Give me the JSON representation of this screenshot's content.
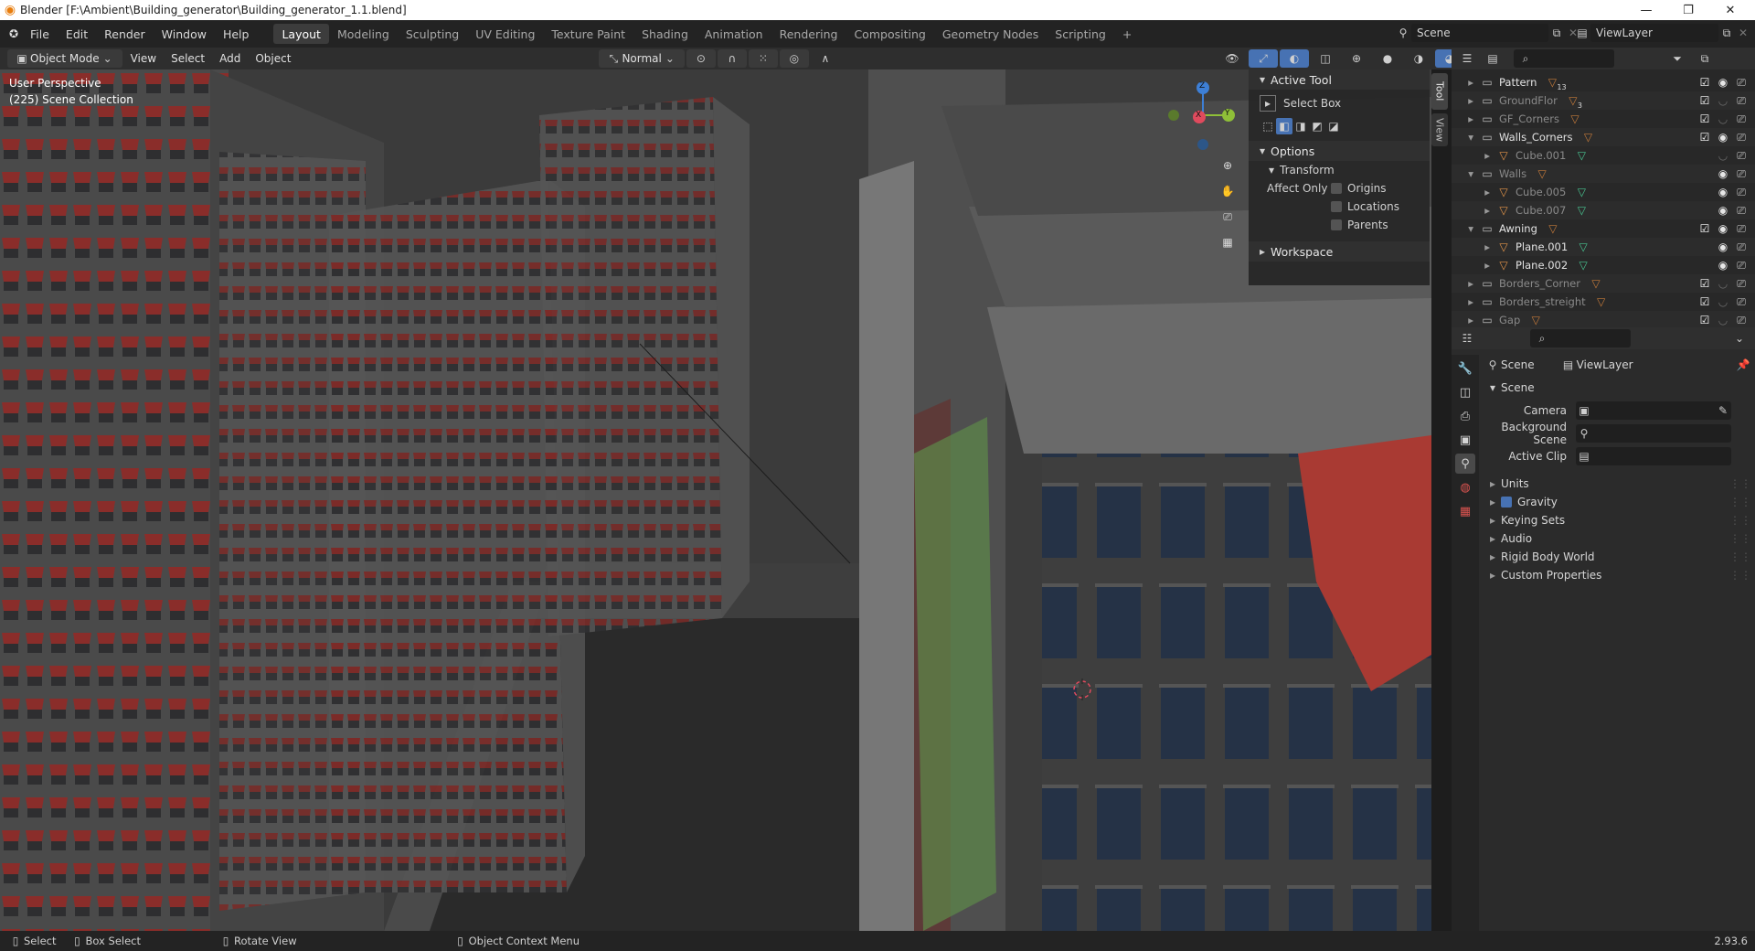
{
  "window": {
    "title": "Blender [F:\\Ambient\\Building_generator\\Building_generator_1.1.blend]",
    "minimize_glyph": "—",
    "restore_glyph": "❐",
    "close_glyph": "✕"
  },
  "menus": [
    "File",
    "Edit",
    "Render",
    "Window",
    "Help"
  ],
  "workspaces": [
    {
      "label": "Layout",
      "active": true
    },
    {
      "label": "Modeling",
      "active": false
    },
    {
      "label": "Sculpting",
      "active": false
    },
    {
      "label": "UV Editing",
      "active": false
    },
    {
      "label": "Texture Paint",
      "active": false
    },
    {
      "label": "Shading",
      "active": false
    },
    {
      "label": "Animation",
      "active": false
    },
    {
      "label": "Rendering",
      "active": false
    },
    {
      "label": "Compositing",
      "active": false
    },
    {
      "label": "Geometry Nodes",
      "active": false
    },
    {
      "label": "Scripting",
      "active": false
    }
  ],
  "add_workspace": "+",
  "scene_selector": {
    "value": "Scene"
  },
  "viewlayer_selector": {
    "value": "ViewLayer"
  },
  "viewport_header": {
    "mode": "Object Mode",
    "menus": [
      "View",
      "Select",
      "Add",
      "Object"
    ],
    "orientation": "Normal"
  },
  "viewport": {
    "perspective_label": "User Perspective",
    "collection_label": "(225) Scene Collection",
    "gizmo": {
      "x": "X",
      "y": "Y",
      "z": "Z"
    }
  },
  "n_panel": {
    "tabs": [
      "Tool",
      "View"
    ],
    "active_tool_title": "Active Tool",
    "active_tool_name": "Select Box",
    "options_title": "Options",
    "transform_title": "Transform",
    "affect_only_label": "Affect Only",
    "affect_options": [
      {
        "label": "Origins",
        "checked": false
      },
      {
        "label": "Locations",
        "checked": false
      },
      {
        "label": "Parents",
        "checked": false
      }
    ],
    "workspace_title": "Workspace"
  },
  "outliner": {
    "rows": [
      {
        "label": "Pattern",
        "indent": 1,
        "expanded": false,
        "dim": false,
        "badge": "13",
        "checked": true,
        "visible": true
      },
      {
        "label": "GroundFlor",
        "indent": 1,
        "expanded": false,
        "dim": true,
        "badge": "3",
        "checked": true,
        "visible": false
      },
      {
        "label": "GF_Corners",
        "indent": 1,
        "expanded": false,
        "dim": true,
        "badge": "",
        "checked": true,
        "visible": false
      },
      {
        "label": "Walls_Corners",
        "indent": 1,
        "expanded": true,
        "dim": false,
        "badge": "",
        "checked": true,
        "visible": true
      },
      {
        "label": "Cube.001",
        "indent": 2,
        "expanded": false,
        "dim": true,
        "badge": "",
        "checked": null,
        "visible": false
      },
      {
        "label": "Walls",
        "indent": 1,
        "expanded": true,
        "dim": true,
        "badge": "",
        "checked": null,
        "visible": true
      },
      {
        "label": "Cube.005",
        "indent": 2,
        "expanded": false,
        "dim": true,
        "badge": "",
        "checked": null,
        "visible": true
      },
      {
        "label": "Cube.007",
        "indent": 2,
        "expanded": false,
        "dim": true,
        "badge": "",
        "checked": null,
        "visible": true
      },
      {
        "label": "Awning",
        "indent": 1,
        "expanded": true,
        "dim": false,
        "badge": "",
        "checked": true,
        "visible": true
      },
      {
        "label": "Plane.001",
        "indent": 2,
        "expanded": false,
        "dim": false,
        "badge": "",
        "checked": null,
        "visible": true
      },
      {
        "label": "Plane.002",
        "indent": 2,
        "expanded": false,
        "dim": false,
        "badge": "",
        "checked": null,
        "visible": true
      },
      {
        "label": "Borders_Corner",
        "indent": 1,
        "expanded": false,
        "dim": true,
        "badge": "",
        "checked": true,
        "visible": false
      },
      {
        "label": "Borders_streight",
        "indent": 1,
        "expanded": false,
        "dim": true,
        "badge": "",
        "checked": true,
        "visible": false
      },
      {
        "label": "Gap",
        "indent": 1,
        "expanded": false,
        "dim": true,
        "badge": "",
        "checked": true,
        "visible": false
      }
    ]
  },
  "properties": {
    "breadcrumb_scene": "Scene",
    "breadcrumb_viewlayer": "ViewLayer",
    "section_title": "Scene",
    "fields": [
      {
        "label": "Camera",
        "value": ""
      },
      {
        "label": "Background Scene",
        "value": ""
      },
      {
        "label": "Active Clip",
        "value": ""
      }
    ],
    "panels": [
      {
        "label": "Units",
        "checkbox": false
      },
      {
        "label": "Gravity",
        "checkbox": true
      },
      {
        "label": "Keying Sets",
        "checkbox": false
      },
      {
        "label": "Audio",
        "checkbox": false
      },
      {
        "label": "Rigid Body World",
        "checkbox": false
      },
      {
        "label": "Custom Properties",
        "checkbox": false
      }
    ]
  },
  "status_bar": {
    "select": "Select",
    "box_select": "Box Select",
    "rotate": "Rotate View",
    "context_menu": "Object Context Menu",
    "version": "2.93.6"
  },
  "colors": {
    "accent": "#4772b3",
    "awning_red": "#a93a33",
    "awning_green": "#5e8a4a",
    "axis_x": "#e04a5d",
    "axis_y": "#8fbf38",
    "axis_z": "#3d7fd6"
  }
}
